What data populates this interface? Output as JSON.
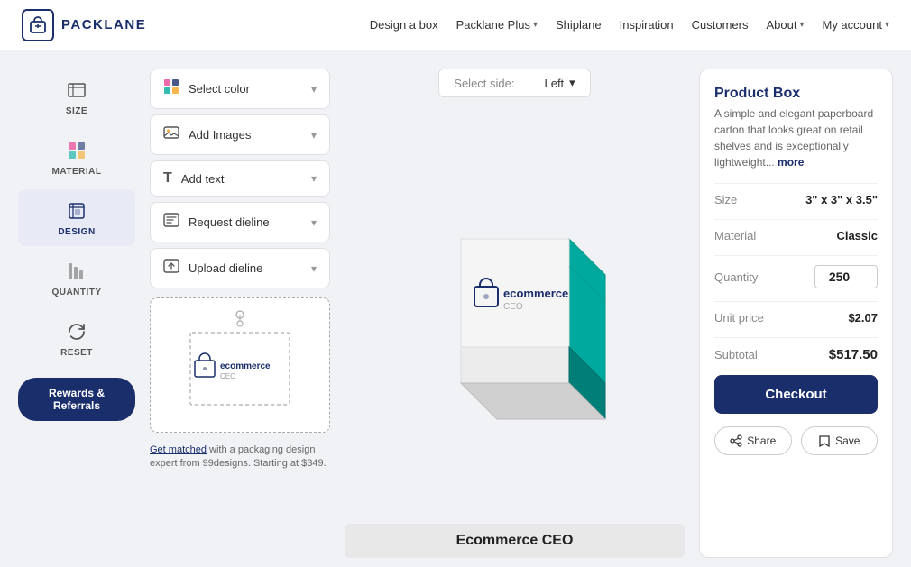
{
  "nav": {
    "logo_text": "PACKLANE",
    "links": [
      {
        "label": "Design a box",
        "has_dropdown": false
      },
      {
        "label": "Packlane Plus",
        "has_dropdown": true
      },
      {
        "label": "Shiplane",
        "has_dropdown": false
      },
      {
        "label": "Inspiration",
        "has_dropdown": false
      },
      {
        "label": "Customers",
        "has_dropdown": false
      },
      {
        "label": "About",
        "has_dropdown": true
      },
      {
        "label": "My account",
        "has_dropdown": true
      }
    ]
  },
  "sidebar": {
    "tools": [
      {
        "id": "size",
        "label": "SIZE",
        "icon": "📐"
      },
      {
        "id": "material",
        "label": "MATERIAL",
        "icon": "🎨"
      },
      {
        "id": "design",
        "label": "DESIGN",
        "icon": "✦",
        "active": true
      },
      {
        "id": "quantity",
        "label": "QUANTITY",
        "icon": "📊"
      },
      {
        "id": "reset",
        "label": "RESET",
        "icon": "↺"
      }
    ],
    "rewards_label": "Rewards & Referrals"
  },
  "design_panel": {
    "options": [
      {
        "label": "Select color",
        "icon": "🎨"
      },
      {
        "label": "Add Images",
        "icon": "🖼"
      },
      {
        "label": "Add text",
        "icon": "T"
      },
      {
        "label": "Request dieline",
        "icon": "📋"
      },
      {
        "label": "Upload dieline",
        "icon": "📄"
      }
    ],
    "get_matched_prefix": "Get matched",
    "get_matched_rest": " with a packaging design expert from 99designs. Starting at $349."
  },
  "center": {
    "select_side_label": "Select side:",
    "select_side_value": "Left",
    "product_display_name": "Ecommerce CEO"
  },
  "product": {
    "title": "Product Box",
    "description": "A simple and elegant paperboard carton that looks great on retail shelves and is exceptionally lightweight...",
    "more_link": "more",
    "specs": [
      {
        "label": "Size",
        "value": "3\" x 3\" x 3.5\""
      },
      {
        "label": "Material",
        "value": "Classic"
      },
      {
        "label": "Quantity",
        "value": "250"
      },
      {
        "label": "Unit price",
        "value": "$2.07"
      },
      {
        "label": "Subtotal",
        "value": "$517.50"
      }
    ],
    "checkout_label": "Checkout",
    "share_label": "Share",
    "save_label": "Save"
  }
}
